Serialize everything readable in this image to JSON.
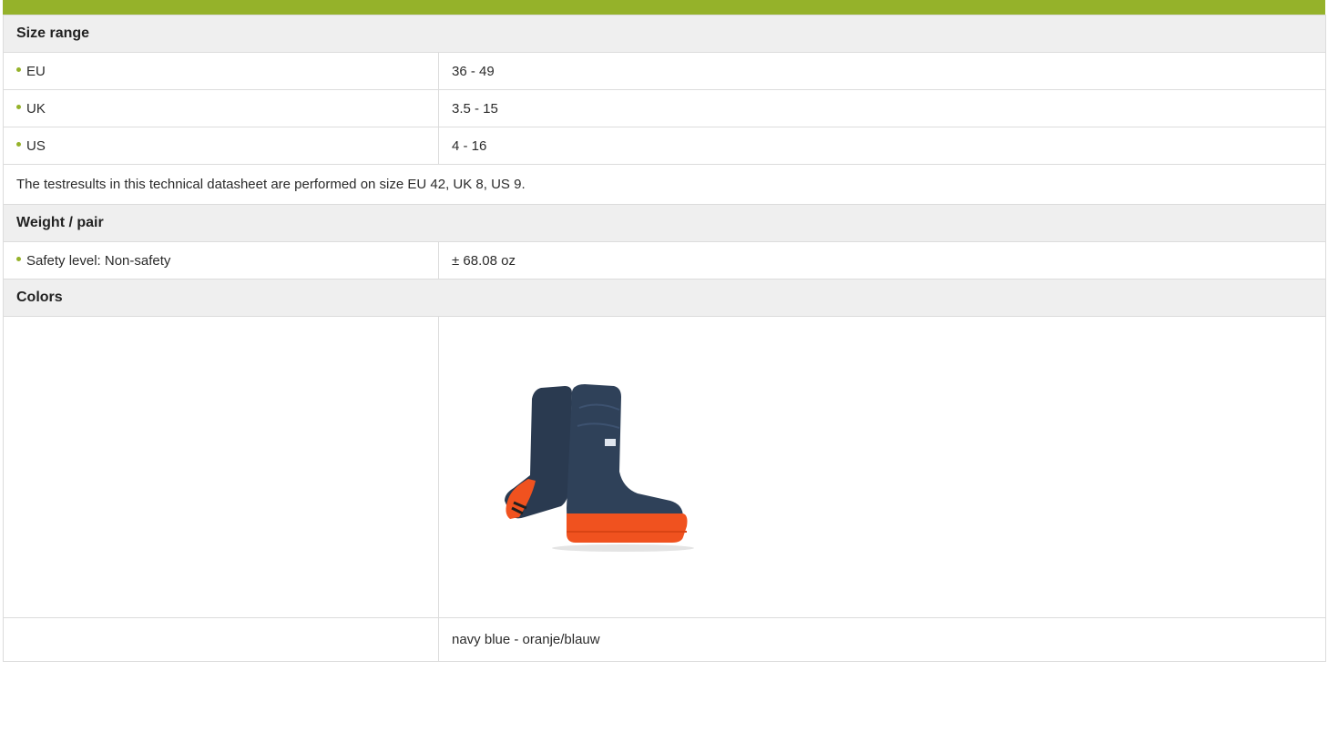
{
  "sections": {
    "size_range": {
      "title": "Size range",
      "rows": [
        {
          "label": "EU",
          "value": "36 - 49"
        },
        {
          "label": "UK",
          "value": "3.5 - 15"
        },
        {
          "label": "US",
          "value": "4 - 16"
        }
      ],
      "note": "The testresults in this technical datasheet are performed on size EU 42, UK 8, US 9."
    },
    "weight": {
      "title": "Weight / pair",
      "rows": [
        {
          "label": "Safety level: Non-safety",
          "value": "± 68.08 oz"
        }
      ]
    },
    "colors": {
      "title": "Colors",
      "image_icon": "rubber-boots-image",
      "caption": "navy blue - oranje/blauw"
    }
  },
  "colors": {
    "accent": "#95b22a",
    "header_bg": "#efefef",
    "border": "#dcdcdc",
    "boot_navy": "#2f4159",
    "boot_orange": "#f0521f"
  }
}
